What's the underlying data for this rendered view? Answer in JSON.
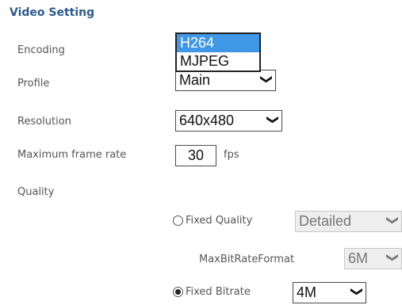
{
  "section_title": "Video Setting",
  "encoding": {
    "label": "Encoding",
    "options": [
      "H264",
      "MJPEG"
    ],
    "selected": "H264"
  },
  "profile": {
    "label": "Profile",
    "value": "Main"
  },
  "resolution": {
    "label": "Resolution",
    "value": "640x480"
  },
  "frame_rate": {
    "label": "Maximum frame rate",
    "value": "30",
    "unit": "fps"
  },
  "quality": {
    "label": "Quality",
    "fixed_quality": {
      "label": "Fixed Quality",
      "value": "Detailed",
      "checked": false
    },
    "max_bitrate_format": {
      "label": "MaxBitRateFormat",
      "value": "6M"
    },
    "fixed_bitrate": {
      "label": "Fixed Bitrate",
      "value": "4M",
      "checked": true
    }
  },
  "icons": {
    "chevron": "chevron-down-icon",
    "radio": "radio-button"
  },
  "colors": {
    "title": "#2b5a8c",
    "highlight": "#3f97e6"
  }
}
